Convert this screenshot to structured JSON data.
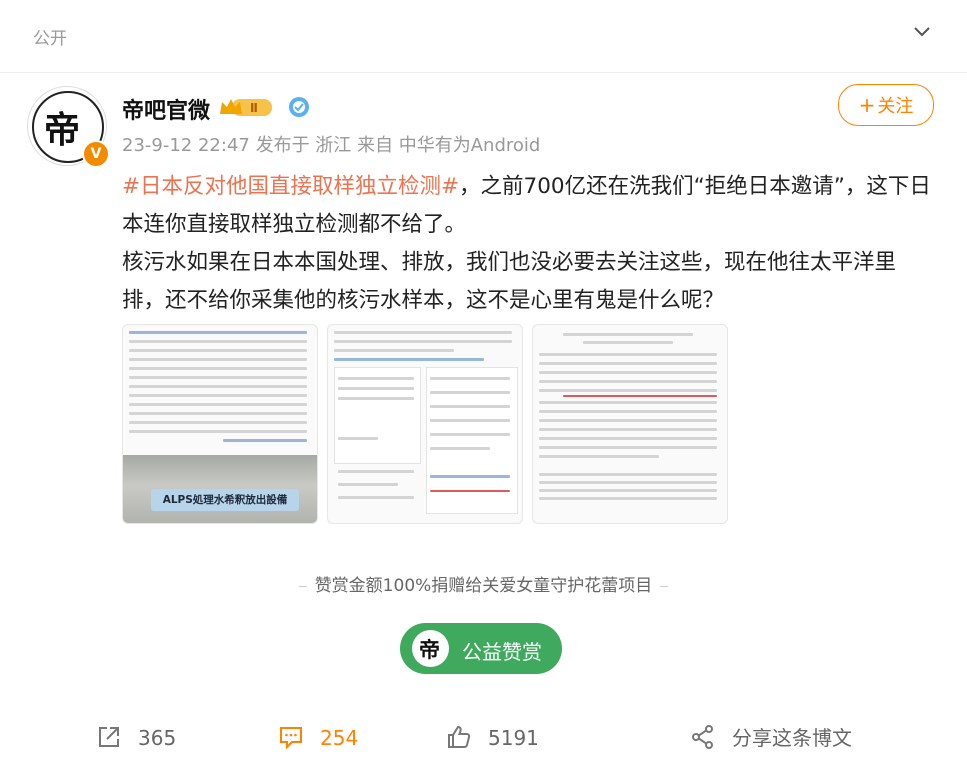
{
  "header": {
    "visibility": "公开"
  },
  "author": {
    "name": "帝吧官微",
    "level_badge": "Ⅱ",
    "verified_badge": "V",
    "avatar_char": "帝",
    "meta": "23-9-12 22:47  发布于 浙江  来自 中华有为Android"
  },
  "follow_button": {
    "plus": "+",
    "label": "关注"
  },
  "post": {
    "hashtag": "#日本反对他国直接取样独立检测#",
    "text1": "，之前700亿还在洗我们“拒绝日本邀请”，这下日本连你直接取样独立检测都不给了。",
    "text2": "核污水如果在日本本国处理、排放，我们也没必要去关注这些，现在他往太平洋里排，还不给你采集他的核污水样本，这不是心里有鬼是什么呢？"
  },
  "images": {
    "image1_plate": "ALPS処理水希釈放出設備"
  },
  "donation_note": "赞赏金额100%捐赠给关爱女童守护花蕾项目",
  "reward_button": {
    "label": "公益赞赏"
  },
  "actions": {
    "repost": "365",
    "comment": "254",
    "like": "5191",
    "share": "分享这条博文"
  },
  "colors": {
    "accent": "#ff8200",
    "hashtag": "#eb7350",
    "reward": "#3fa95e"
  }
}
